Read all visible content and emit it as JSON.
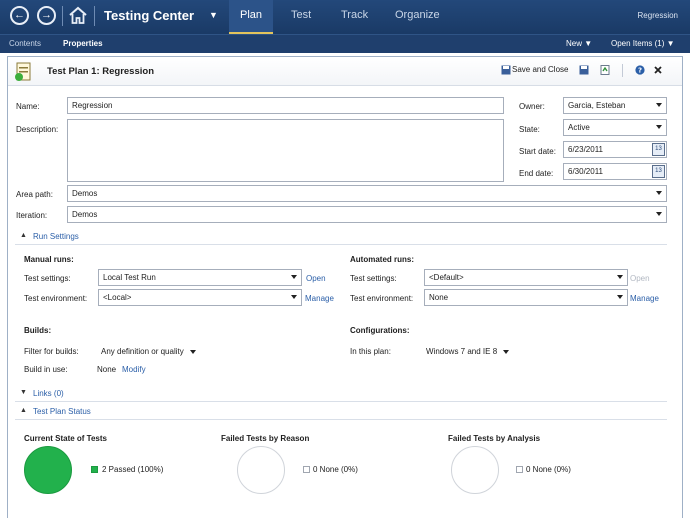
{
  "nav": {
    "title": "Testing Center",
    "tabs": [
      "Plan",
      "Test",
      "Track",
      "Organize"
    ],
    "active_tab": "Plan",
    "right_label": "Regression",
    "sub_items": [
      "Contents",
      "Properties"
    ],
    "new_label": "New",
    "open_items_label": "Open Items (1)"
  },
  "header": {
    "title": "Test Plan 1: Regression",
    "save_close_label": "Save and Close"
  },
  "form": {
    "name_label": "Name:",
    "name_value": "Regression",
    "description_label": "Description:",
    "description_value": "",
    "owner_label": "Owner:",
    "owner_value": "Garcia, Esteban",
    "state_label": "State:",
    "state_value": "Active",
    "start_label": "Start date:",
    "start_value": "6/23/2011",
    "end_label": "End date:",
    "end_value": "6/30/2011",
    "area_label": "Area path:",
    "area_value": "Demos",
    "iteration_label": "Iteration:",
    "iteration_value": "Demos",
    "calendar_glyph": "13"
  },
  "run_settings": {
    "title": "Run Settings",
    "manual_title": "Manual runs:",
    "auto_title": "Automated runs:",
    "test_settings_label": "Test settings:",
    "test_env_label": "Test environment:",
    "manual_settings_value": "Local Test Run",
    "manual_env_value": "<Local>",
    "auto_settings_value": "<Default>",
    "auto_env_value": "None",
    "open_label": "Open",
    "manage_label": "Manage",
    "builds_title": "Builds:",
    "filter_label": "Filter for builds:",
    "filter_value": "Any definition or quality",
    "build_in_use_label": "Build in use:",
    "build_in_use_value": "None",
    "modify_label": "Modify",
    "config_title": "Configurations:",
    "in_plan_label": "In this plan:",
    "in_plan_value": "Windows 7 and IE 8"
  },
  "links": {
    "title": "Links (0)"
  },
  "status": {
    "title": "Test Plan Status",
    "charts": [
      {
        "title": "Current State of Tests",
        "legend": "2 Passed (100%)",
        "color": "#22b14c"
      },
      {
        "title": "Failed Tests by Reason",
        "legend": "0 None (0%)",
        "color": "#ffffff"
      },
      {
        "title": "Failed Tests by Analysis",
        "legend": "0 None (0%)",
        "color": "#ffffff"
      }
    ]
  }
}
